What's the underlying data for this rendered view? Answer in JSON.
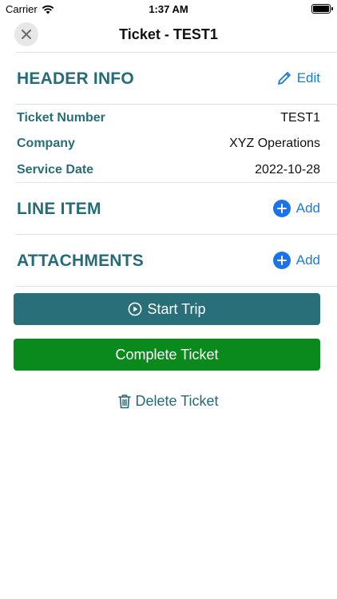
{
  "status_bar": {
    "carrier": "Carrier",
    "time": "1:37 AM"
  },
  "nav": {
    "title": "Ticket - TEST1"
  },
  "header_info": {
    "title": "HEADER INFO",
    "edit_label": "Edit",
    "fields": [
      {
        "label": "Ticket Number",
        "value": "TEST1"
      },
      {
        "label": "Company",
        "value": "XYZ Operations"
      },
      {
        "label": "Service Date",
        "value": "2022-10-28"
      }
    ]
  },
  "line_item": {
    "title": "LINE ITEM",
    "add_label": "Add"
  },
  "attachments": {
    "title": "ATTACHMENTS",
    "add_label": "Add"
  },
  "actions": {
    "start_trip": "Start Trip",
    "complete_ticket": "Complete Ticket",
    "delete_ticket": "Delete Ticket"
  },
  "colors": {
    "section_title": "#256c77",
    "action_blue": "#1d7ad6",
    "start_trip_bg": "#296f79",
    "complete_bg": "#0a8a1c"
  }
}
